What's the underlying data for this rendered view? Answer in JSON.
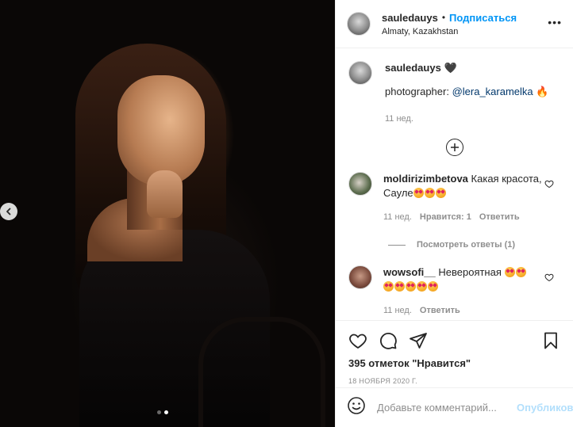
{
  "post": {
    "username": "sauledauys",
    "bullet": "•",
    "follow_label": "Подписаться",
    "location": "Almaty, Kazakhstan",
    "more_label": "•••",
    "caption_user": "sauledauys",
    "caption_badge": "🖤",
    "caption_prefix": "photographer: ",
    "caption_mention": "@lera_karamelka",
    "caption_emoji": "🔥",
    "caption_time": "11 нед.",
    "carousel": {
      "count": 2,
      "active_index": 1
    }
  },
  "comments": [
    {
      "username": "moldirizimbetova",
      "text": "Какая красота, Сауле",
      "emoji_count": 3,
      "time": "11 нед.",
      "likes_label": "Нравится: 1",
      "reply_label": "Ответить"
    },
    {
      "username": "wowsofi__",
      "text": "Невероятная",
      "emoji_count": 2,
      "emoji_count_line2": 5,
      "time": "11 нед.",
      "reply_label": "Ответить"
    }
  ],
  "replies_label": "Посмотреть ответы (1)",
  "likes": "395 отметок \"Нравится\"",
  "date": "18 НОЯБРЯ 2020 Г.",
  "add_comment": {
    "placeholder": "Добавьте комментарий...",
    "publish_label": "Опубликовать"
  },
  "colors": {
    "accent": "#0095f6",
    "publish_disabled": "#b2dffc",
    "secondary_text": "#8e8e8e",
    "mention": "#00376b"
  },
  "icons": [
    "chevron-left-icon",
    "plus-circle-icon",
    "heart-icon",
    "comment-icon",
    "share-icon",
    "bookmark-icon",
    "smile-icon"
  ]
}
